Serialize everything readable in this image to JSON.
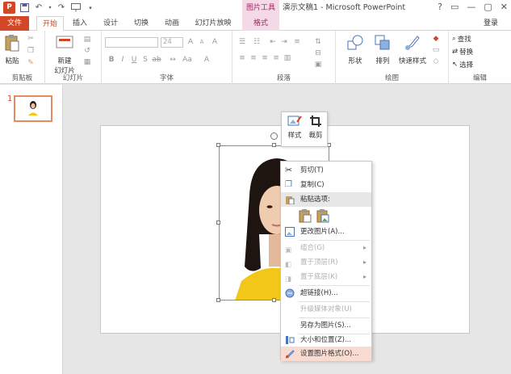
{
  "app": {
    "logo_text": "P",
    "context_tool_title": "图片工具",
    "document_title": "演示文稿1 - Microsoft PowerPoint",
    "window_controls": [
      "?",
      "▭",
      "—",
      "▢",
      "✕"
    ]
  },
  "tabs": {
    "file": "文件",
    "home": "开始",
    "insert": "插入",
    "design": "设计",
    "transitions": "切换",
    "animations": "动画",
    "slideshow": "幻灯片放映",
    "format": "格式",
    "login": "登录"
  },
  "ribbon": {
    "clipboard": {
      "paste": "粘贴",
      "label": "剪贴板"
    },
    "slides": {
      "new_slide_line1": "新建",
      "new_slide_line2": "幻灯片",
      "label": "幻灯片"
    },
    "font": {
      "size_value": "24",
      "label": "字体",
      "bold": "B",
      "italic": "I",
      "underline": "U",
      "shadow": "S"
    },
    "paragraph": {
      "label": "段落"
    },
    "drawing": {
      "shapes": "形状",
      "arrange": "排列",
      "quick_styles": "快速样式",
      "label": "绘图"
    },
    "editing": {
      "find": "查找",
      "replace": "替换",
      "select": "选择",
      "label": "编辑"
    }
  },
  "slides_pane": {
    "slide_number": "1"
  },
  "mini_toolbar": {
    "style": "样式",
    "crop": "裁剪"
  },
  "context_menu": {
    "items": [
      {
        "label": "剪切(T)",
        "state": "enabled"
      },
      {
        "label": "复制(C)",
        "state": "enabled"
      },
      {
        "label": "粘贴选项:",
        "state": "header"
      },
      {
        "label": "更改图片(A)...",
        "state": "enabled"
      },
      {
        "label": "组合(G)",
        "state": "disabled"
      },
      {
        "label": "置于顶层(R)",
        "state": "disabled"
      },
      {
        "label": "置于底层(K)",
        "state": "disabled"
      },
      {
        "label": "超链接(H)...",
        "state": "enabled"
      },
      {
        "label": "升级媒体对象(U)",
        "state": "disabled"
      },
      {
        "label": "另存为图片(S)...",
        "state": "enabled"
      },
      {
        "label": "大小和位置(Z)...",
        "state": "enabled"
      },
      {
        "label": "设置图片格式(O)...",
        "state": "highlighted"
      }
    ]
  },
  "colors": {
    "accent": "#d24726",
    "context_tab": "#f4d9e6",
    "menu_highlight": "#f8dcd1",
    "shirt": "#f3c71a"
  }
}
